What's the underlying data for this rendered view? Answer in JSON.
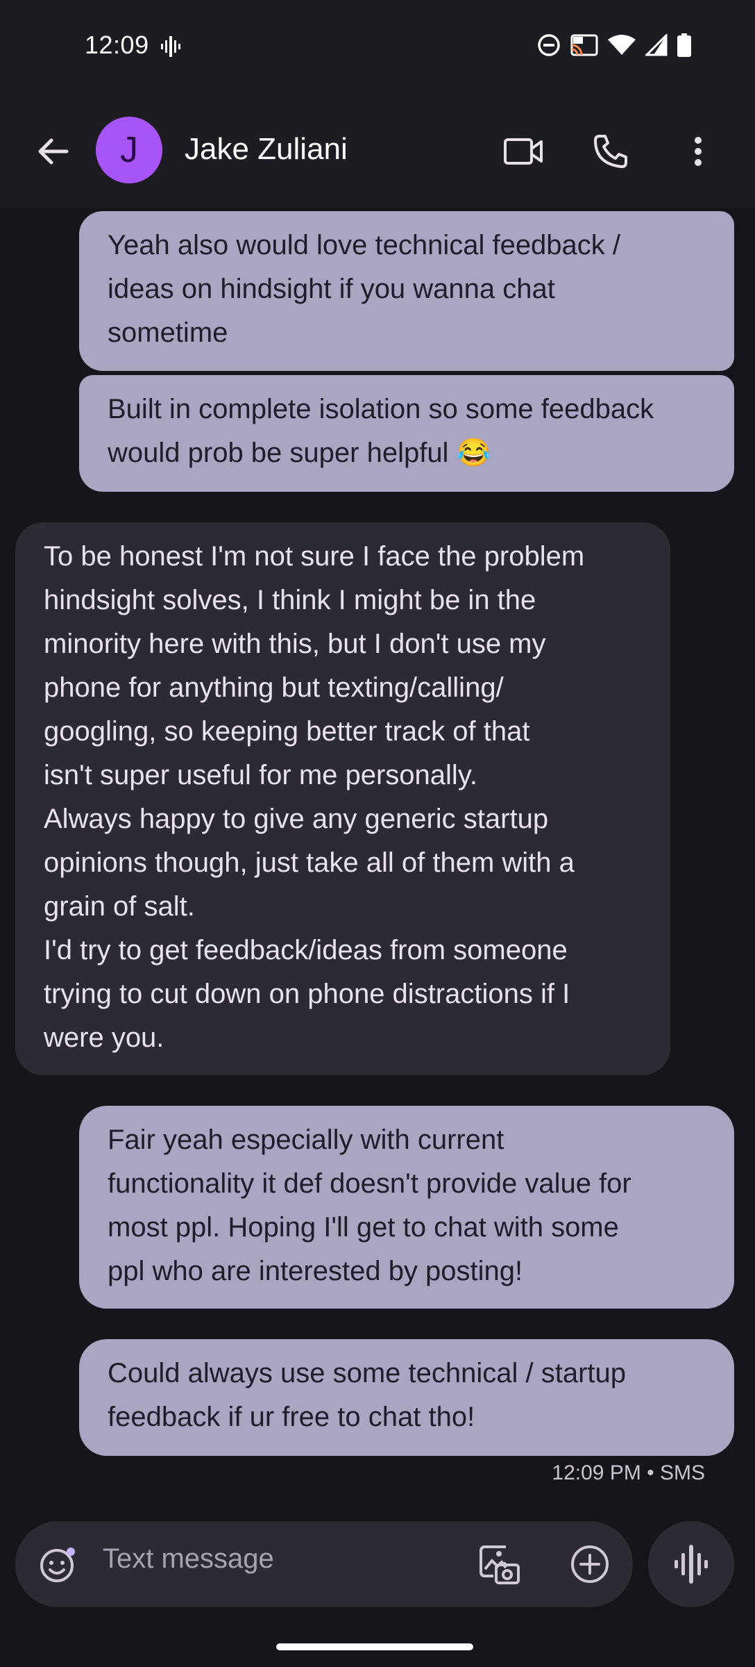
{
  "status_bar": {
    "time": "12:09"
  },
  "header": {
    "avatar_letter": "J",
    "contact_name": "Jake Zuliani"
  },
  "messages": [
    {
      "direction": "outgoing",
      "text": "Yeah also would love technical feedback /\nideas on hindsight if you wanna chat\nsometime"
    },
    {
      "direction": "outgoing",
      "text": "Built in complete isolation so some feedback\nwould prob be super helpful 😂"
    },
    {
      "direction": "incoming",
      "text": "To be honest I'm not sure I face the problem\nhindsight solves, I think I might be in the\nminority here with this, but I don't use my\nphone for anything but texting/calling/\ngoogling, so keeping better track of that\nisn't super useful for me personally.\nAlways happy to give any generic startup\nopinions though, just take all of them with a\ngrain of salt.\nI'd try to get feedback/ideas from someone\ntrying to cut down on phone distractions if I\nwere you."
    },
    {
      "direction": "outgoing",
      "text": "Fair yeah especially with current\nfunctionality it def doesn't provide value for\nmost ppl. Hoping I'll get to chat with some\nppl who are interested by posting!"
    },
    {
      "direction": "outgoing",
      "text": "Could always use some technical / startup\nfeedback if ur free to chat tho!"
    }
  ],
  "last_message_meta": "12:09 PM • SMS",
  "composer": {
    "placeholder": "Text message"
  },
  "icons": {
    "back": "arrow-left-icon",
    "video_call": "video-camera-icon",
    "call": "phone-icon",
    "more": "more-vert-icon",
    "emoji": "emoji-icon",
    "gallery": "gallery-icon",
    "attach": "plus-circle-icon",
    "voice": "voice-waveform-icon"
  },
  "colors": {
    "outgoing_bubble": "#a9a6c2",
    "incoming_bubble": "#2c2b33",
    "avatar": "#a855f7",
    "background": "#16151b"
  }
}
